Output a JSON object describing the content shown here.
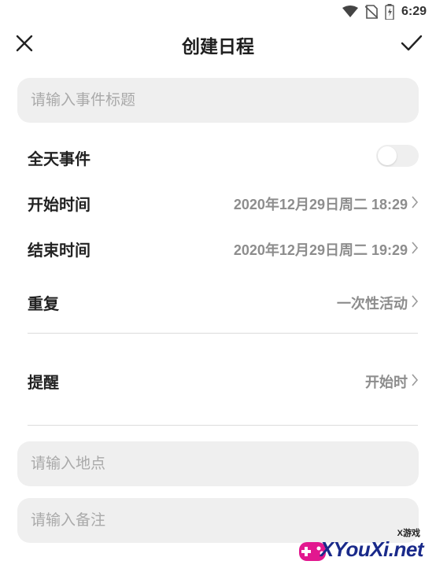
{
  "status_bar": {
    "time": "6:29",
    "icons": [
      "wifi-icon",
      "no-sim-icon",
      "battery-icon"
    ]
  },
  "header": {
    "title": "创建日程",
    "left_icon": "close-icon",
    "right_icon": "check-icon"
  },
  "form": {
    "title_placeholder": "请输入事件标题",
    "all_day": {
      "label": "全天事件",
      "enabled": false
    },
    "start": {
      "label": "开始时间",
      "value": "2020年12月29日周二 18:29"
    },
    "end": {
      "label": "结束时间",
      "value": "2020年12月29日周二 19:29"
    },
    "repeat": {
      "label": "重复",
      "value": "一次性活动"
    },
    "reminder": {
      "label": "提醒",
      "value": "开始时"
    },
    "location_placeholder": "请输入地点",
    "notes_placeholder": "请输入备注"
  },
  "watermark": {
    "brand": "XYouXi.net",
    "sub": "X游戏"
  },
  "colors": {
    "input_bg": "#efefef",
    "value_text": "#8d8d8d",
    "divider": "#dcdcdc",
    "watermark_blue": "#1a2a8a"
  }
}
